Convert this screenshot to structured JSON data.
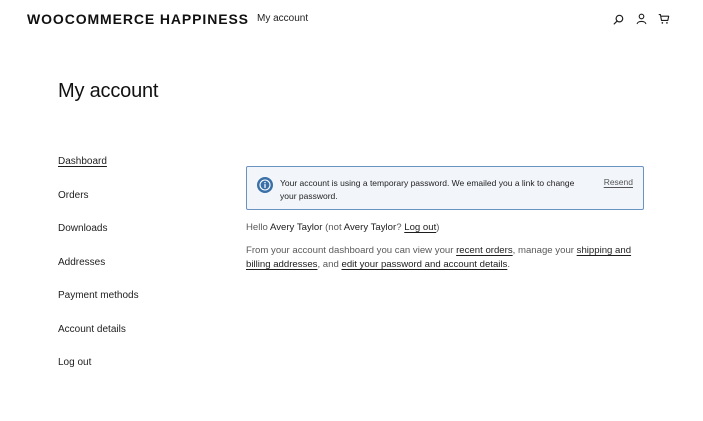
{
  "header": {
    "site_title": "WOOCOMMERCE HAPPINESS",
    "nav_my_account": "My account",
    "icons": [
      "search-icon",
      "user-icon",
      "cart-icon"
    ]
  },
  "page": {
    "title": "My account"
  },
  "account_nav": {
    "items": [
      "Dashboard",
      "Orders",
      "Downloads",
      "Addresses",
      "Payment methods",
      "Account details",
      "Log out"
    ],
    "active": "Dashboard"
  },
  "notice": {
    "message": "Your account is using a temporary password. We emailed you a link to change your password.",
    "resend_label": "Resend",
    "colors": {
      "background": "#f2f6fb",
      "border": "#6b93c2",
      "icon": "#3b6fa8"
    }
  },
  "dashboard": {
    "hello_prefix": "Hello ",
    "user_name": "Avery Taylor",
    "not_prefix": " (not ",
    "not_suffix": "? ",
    "logout_link": "Log out",
    "close_paren": ")",
    "desc_1": "From your account dashboard you can view your ",
    "link_recent_orders": "recent orders",
    "desc_2": ", manage your ",
    "link_addresses": "shipping and billing addresses",
    "desc_3": ", and ",
    "link_account_details": "edit your password and account details",
    "desc_4": "."
  }
}
